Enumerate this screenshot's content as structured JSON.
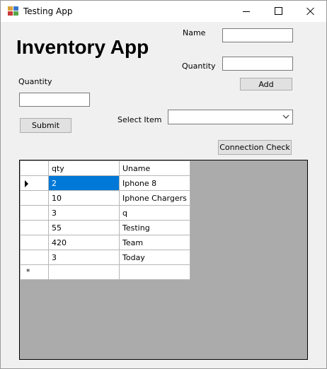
{
  "window": {
    "title": "Testing App"
  },
  "heading": "Inventory App",
  "form": {
    "name_label": "Name",
    "name_value": "",
    "top_quantity_label": "Quantity",
    "top_quantity_value": "",
    "add_label": "Add",
    "quantity_label": "Quantity",
    "quantity_value": "",
    "submit_label": "Submit",
    "select_label": "Select Item",
    "select_value": "",
    "connection_check_label": "Connection Check"
  },
  "grid": {
    "columns": [
      "qty",
      "Uname"
    ],
    "rows": [
      {
        "qty": "2",
        "uname": "Iphone 8"
      },
      {
        "qty": "10",
        "uname": "Iphone Chargers"
      },
      {
        "qty": "3",
        "uname": "q"
      },
      {
        "qty": "55",
        "uname": "Testing"
      },
      {
        "qty": "420",
        "uname": "Team"
      },
      {
        "qty": "3",
        "uname": "Today"
      }
    ],
    "new_row_marker": "*",
    "selected_cell_color": "#0078d7"
  },
  "icons": {
    "app": "winforms-app-icon",
    "minimize": "minimize-icon",
    "maximize": "maximize-icon",
    "close": "close-icon",
    "combo_arrow": "chevron-down-icon",
    "row_pointer": "current-row-arrow-icon"
  }
}
